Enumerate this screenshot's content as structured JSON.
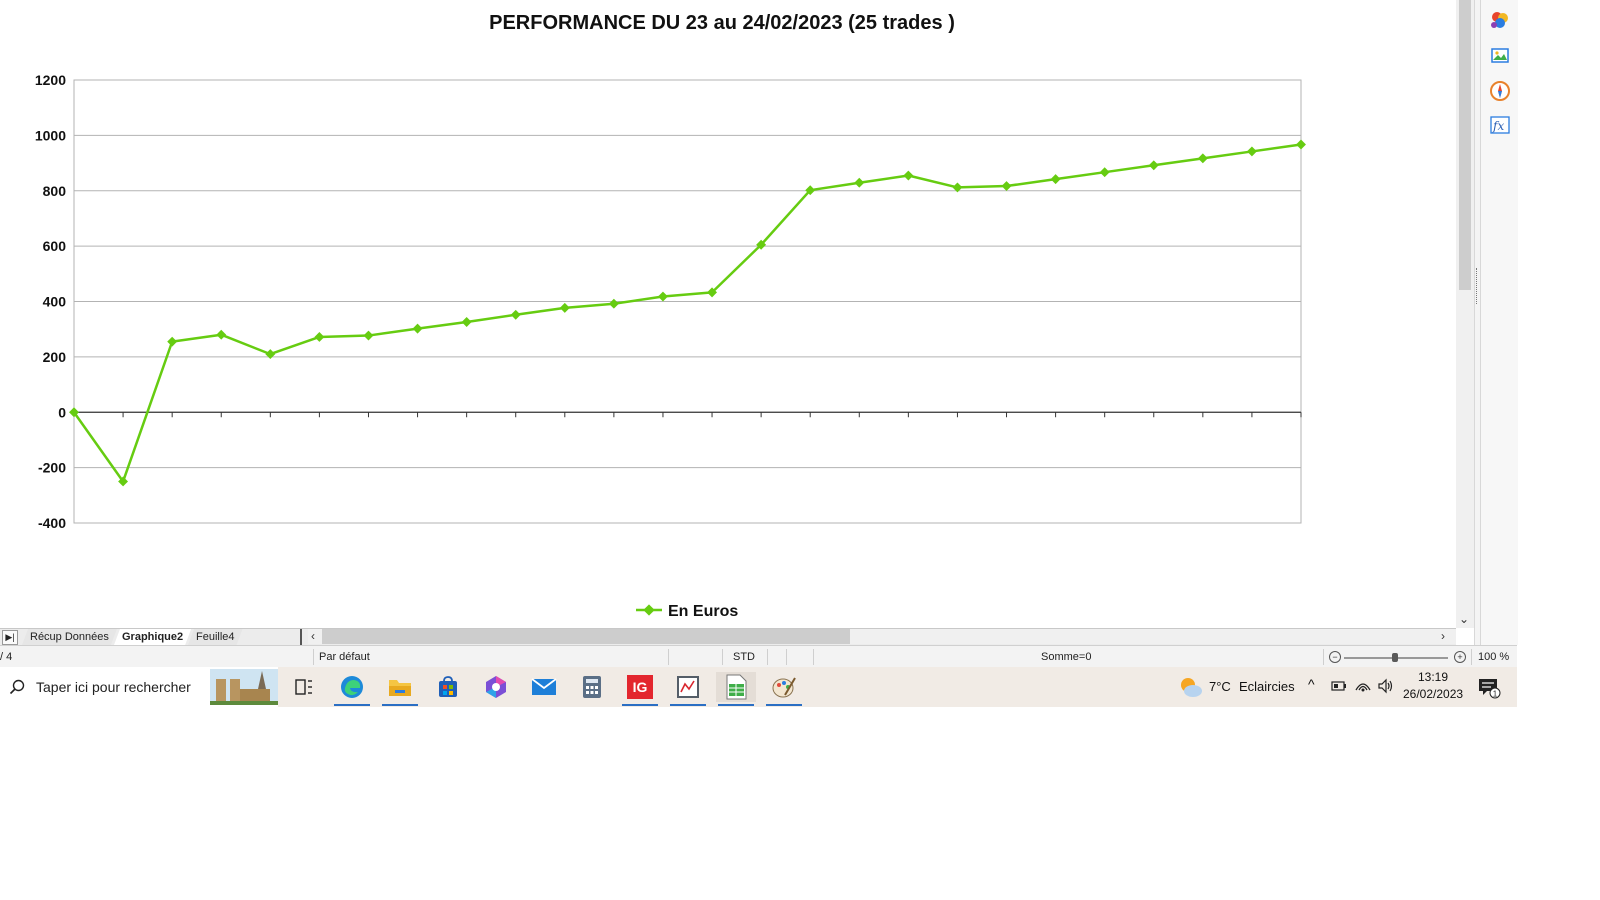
{
  "chart_data": {
    "type": "line",
    "title": "PERFORMANCE DU 23 au 24/02/2023 (25 trades )",
    "xlabel": "",
    "ylabel": "",
    "ylim": [
      -400,
      1200
    ],
    "yticks": [
      "1200",
      "1000",
      "800",
      "600",
      "400",
      "200",
      "0",
      "-200",
      "-400"
    ],
    "grid": true,
    "legend_position": "bottom",
    "series": [
      {
        "name": "En Euros",
        "color": "#66cc11",
        "marker": "diamond",
        "x": [
          0,
          1,
          2,
          3,
          4,
          5,
          6,
          7,
          8,
          9,
          10,
          11,
          12,
          13,
          14,
          15,
          16,
          17,
          18,
          19,
          20,
          21,
          22,
          23,
          24,
          25
        ],
        "values": [
          0,
          -250,
          255,
          280,
          210,
          272,
          277,
          302,
          326,
          352,
          377,
          392,
          418,
          433,
          605,
          802,
          829,
          855,
          812,
          817,
          842,
          867,
          892,
          917,
          942,
          967
        ]
      }
    ]
  },
  "sheet_tabs": {
    "nav_icon": "tab-last-icon",
    "tabs": [
      "Récup Données",
      "Graphique2",
      "Feuille4"
    ],
    "active": "Graphique2"
  },
  "statusbar": {
    "sheet_position": "/ 4",
    "page_style": "Par défaut",
    "mode": "STD",
    "sum": "Somme=0",
    "zoom": "100 %",
    "zoom_level_percent": 100
  },
  "sidebar": {
    "icons": [
      "styles-icon",
      "gallery-icon",
      "navigator-icon",
      "functions-icon"
    ]
  },
  "taskbar": {
    "search_placeholder": "Taper ici pour rechercher",
    "apps": [
      "task-view-icon",
      "edge-icon",
      "file-explorer-icon",
      "store-icon",
      "copilot-icon",
      "mail-icon",
      "calculator-icon",
      "ig-icon",
      "chart-app-icon",
      "libreoffice-calc-icon",
      "paint-icon"
    ],
    "ig_label": "IG",
    "weather_temp": "7°C",
    "weather_desc": "Eclaircies",
    "time": "13:19",
    "date": "26/02/2023",
    "notification_count": "1"
  },
  "colors": {
    "series": "#66cc11",
    "taskbar": "#f1ebe5",
    "accent": "#2b6fc4"
  }
}
